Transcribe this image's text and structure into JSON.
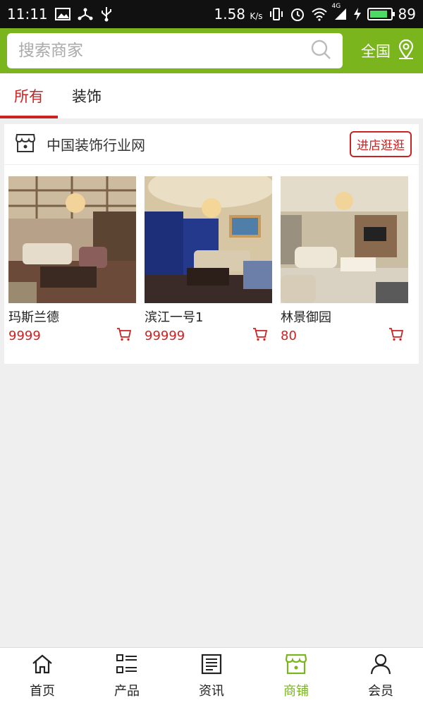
{
  "status_bar": {
    "time": "11:11",
    "speed": "1.58",
    "speed_unit": "K/s",
    "network": "4G",
    "battery": "89",
    "battery_level": 0.89
  },
  "search": {
    "placeholder": "搜索商家",
    "region_label": "全国"
  },
  "tabs": [
    {
      "label": "所有",
      "active": true
    },
    {
      "label": "装饰",
      "active": false
    }
  ],
  "shop": {
    "name": "中国装饰行业网",
    "enter_label": "进店逛逛",
    "products": [
      {
        "name": "玛斯兰德",
        "price": "9999"
      },
      {
        "name": "滨江一号1",
        "price": "99999"
      },
      {
        "name": "林景御园",
        "price": "80"
      }
    ]
  },
  "bottom_nav": [
    {
      "label": "首页",
      "icon": "home-icon",
      "active": false
    },
    {
      "label": "产品",
      "icon": "list-icon",
      "active": false
    },
    {
      "label": "资讯",
      "icon": "news-icon",
      "active": false
    },
    {
      "label": "商铺",
      "icon": "store-icon",
      "active": true
    },
    {
      "label": "会员",
      "icon": "user-icon",
      "active": false
    }
  ],
  "colors": {
    "accent": "#7ab51d",
    "price": "#cc2222"
  }
}
